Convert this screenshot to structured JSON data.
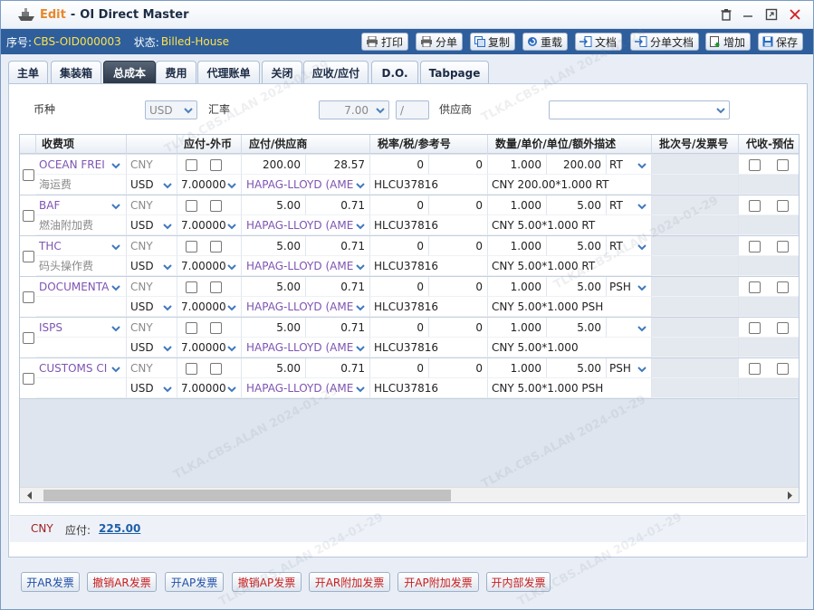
{
  "window": {
    "mode": "Edit",
    "title": "OI Direct Master"
  },
  "infobar": {
    "seq_label": "序号:",
    "seq_value": "CBS-OID000003",
    "status_label": "状态:",
    "status_value": "Billed-House"
  },
  "toolbar": {
    "print": "打印",
    "split": "分单",
    "copy": "复制",
    "reload": "重载",
    "docs": "文档",
    "split_docs": "分单文档",
    "add": "增加",
    "save": "保存"
  },
  "tabs": [
    "主单",
    "集装箱",
    "总成本",
    "费用",
    "代理账单",
    "关闭",
    "应收/应付",
    "D.O.",
    "Tabpage"
  ],
  "filter": {
    "currency_label": "币种",
    "currency_value": "USD",
    "rate_label": "汇率",
    "rate_value": "7.00",
    "rate_sep": "/",
    "supplier_label": "供应商",
    "supplier_value": ""
  },
  "grid": {
    "headers": [
      "收费项",
      "应付-外币",
      "应付/供应商",
      "税率/税/参考号",
      "数量/单价/单位/额外描述",
      "批次号/发票号",
      "代收-预估"
    ],
    "rows": [
      {
        "code": "OCEAN FREI",
        "cny": "CNY",
        "amt": "200.00",
        "amt2": "28.57",
        "tax": "0",
        "tax2": "0",
        "qty": "1.000",
        "price": "200.00",
        "unit": "RT",
        "name_cn": "海运费",
        "usd": "USD",
        "rate": "7.00000",
        "vendor": "HAPAG-LLOYD (AME",
        "ref": "HLCU37816",
        "desc": "CNY 200.00*1.000 RT"
      },
      {
        "code": "BAF",
        "cny": "CNY",
        "amt": "5.00",
        "amt2": "0.71",
        "tax": "0",
        "tax2": "0",
        "qty": "1.000",
        "price": "5.00",
        "unit": "RT",
        "name_cn": "燃油附加费",
        "usd": "USD",
        "rate": "7.00000",
        "vendor": "HAPAG-LLOYD (AME",
        "ref": "HLCU37816",
        "desc": "CNY 5.00*1.000 RT"
      },
      {
        "code": "THC",
        "cny": "CNY",
        "amt": "5.00",
        "amt2": "0.71",
        "tax": "0",
        "tax2": "0",
        "qty": "1.000",
        "price": "5.00",
        "unit": "RT",
        "name_cn": "码头操作费",
        "usd": "USD",
        "rate": "7.00000",
        "vendor": "HAPAG-LLOYD (AME",
        "ref": "HLCU37816",
        "desc": "CNY 5.00*1.000 RT"
      },
      {
        "code": "DOCUMENTA",
        "cny": "CNY",
        "amt": "5.00",
        "amt2": "0.71",
        "tax": "0",
        "tax2": "0",
        "qty": "1.000",
        "price": "5.00",
        "unit": "PSH",
        "name_cn": "",
        "usd": "USD",
        "rate": "7.00000",
        "vendor": "HAPAG-LLOYD (AME",
        "ref": "HLCU37816",
        "desc": "CNY 5.00*1.000 PSH"
      },
      {
        "code": "ISPS",
        "cny": "CNY",
        "amt": "5.00",
        "amt2": "0.71",
        "tax": "0",
        "tax2": "0",
        "qty": "1.000",
        "price": "5.00",
        "unit": "",
        "name_cn": "",
        "usd": "USD",
        "rate": "7.00000",
        "vendor": "HAPAG-LLOYD (AME",
        "ref": "HLCU37816",
        "desc": "CNY 5.00*1.000"
      },
      {
        "code": "CUSTOMS CI",
        "cny": "CNY",
        "amt": "5.00",
        "amt2": "0.71",
        "tax": "0",
        "tax2": "0",
        "qty": "1.000",
        "price": "5.00",
        "unit": "PSH",
        "name_cn": "",
        "usd": "USD",
        "rate": "7.00000",
        "vendor": "HAPAG-LLOYD (AME",
        "ref": "HLCU37816",
        "desc": "CNY 5.00*1.000 PSH"
      }
    ]
  },
  "footer": {
    "currency": "CNY",
    "payable_label": "应付:",
    "payable_value": "225.00"
  },
  "bottom_buttons": [
    "开AR发票",
    "撤销AR发票",
    "开AP发票",
    "撤销AP发票",
    "开AR附加发票",
    "开AP附加发票",
    "开内部发票"
  ],
  "watermark": "TLKA.CBS.ALAN 2024-01-29",
  "colors": {
    "infobar": "#2e5e9c",
    "status": "#ffe34b",
    "code": "#7e54b3",
    "link": "#1f5fa8",
    "title_mode": "#e8872a"
  }
}
